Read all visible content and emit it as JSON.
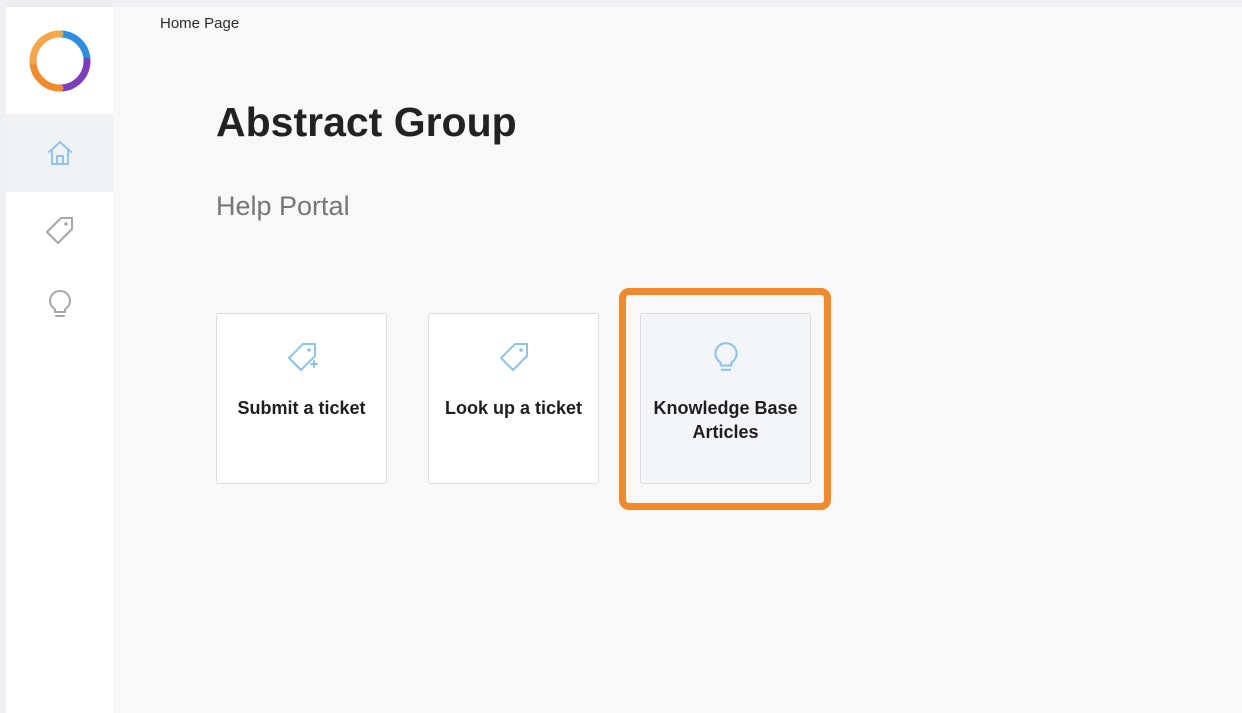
{
  "breadcrumb": "Home Page",
  "header": {
    "title": "Abstract Group",
    "subtitle": "Help Portal"
  },
  "sidebar": {
    "logo_icon": "ring-logo",
    "items": [
      {
        "name": "home",
        "icon": "home-icon",
        "active": true
      },
      {
        "name": "tickets",
        "icon": "tag-icon",
        "active": false
      },
      {
        "name": "knowledge-base",
        "icon": "lightbulb-icon",
        "active": false
      }
    ]
  },
  "cards": [
    {
      "label": "Submit a ticket",
      "icon": "tag-plus-icon"
    },
    {
      "label": "Look up a ticket",
      "icon": "tag-icon"
    },
    {
      "label": "Knowledge Base Articles",
      "icon": "lightbulb-icon",
      "highlighted": true
    }
  ],
  "colors": {
    "highlight": "#ef8b2e",
    "icon_blue": "#8ec3ea",
    "icon_gray": "#a7a7a7"
  }
}
